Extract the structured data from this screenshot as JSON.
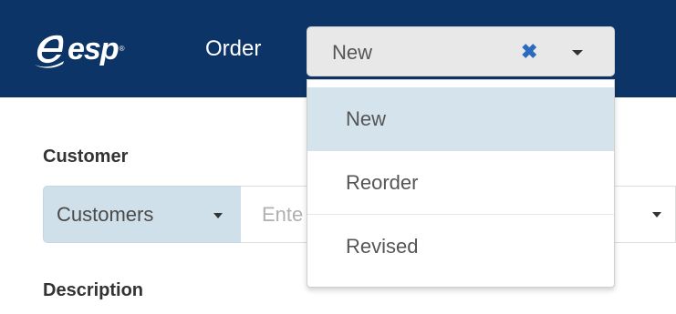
{
  "header": {
    "logo_text": "esp",
    "logo_reg": "®",
    "order_label": "Order",
    "order_select": {
      "value": "New",
      "clear_icon": "times-icon",
      "caret_icon": "caret-down-icon"
    }
  },
  "dropdown": {
    "options": [
      {
        "label": "New",
        "selected": true
      },
      {
        "label": "Reorder",
        "selected": false
      },
      {
        "label": "Revised",
        "selected": false
      }
    ]
  },
  "form": {
    "customer_label": "Customer",
    "customer_type": "Customers",
    "customer_placeholder": "Ente",
    "description_label": "Description"
  },
  "colors": {
    "header_bg": "#0d3466",
    "accent": "#2a6bbf",
    "selected_option_bg": "#d4e3ec",
    "addon_bg": "#cfe0ea"
  }
}
